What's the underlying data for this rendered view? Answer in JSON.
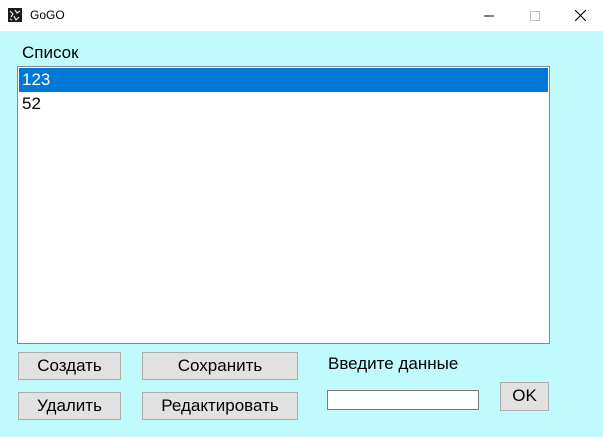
{
  "window": {
    "title": "GoGO",
    "app_icon": "app-logo-icon",
    "controls": [
      "minimize-icon",
      "maximize-icon",
      "close-icon"
    ]
  },
  "list": {
    "label": "Список",
    "items": [
      "123",
      "52"
    ],
    "selected_index": 0,
    "selection_color": "#0078d7"
  },
  "buttons": {
    "create": "Создать",
    "save": "Сохранить",
    "delete": "Удалить",
    "edit": "Редактировать",
    "ok": "OK"
  },
  "input": {
    "label": "Введите данные",
    "value": ""
  },
  "colors": {
    "background": "#c0fafc"
  }
}
